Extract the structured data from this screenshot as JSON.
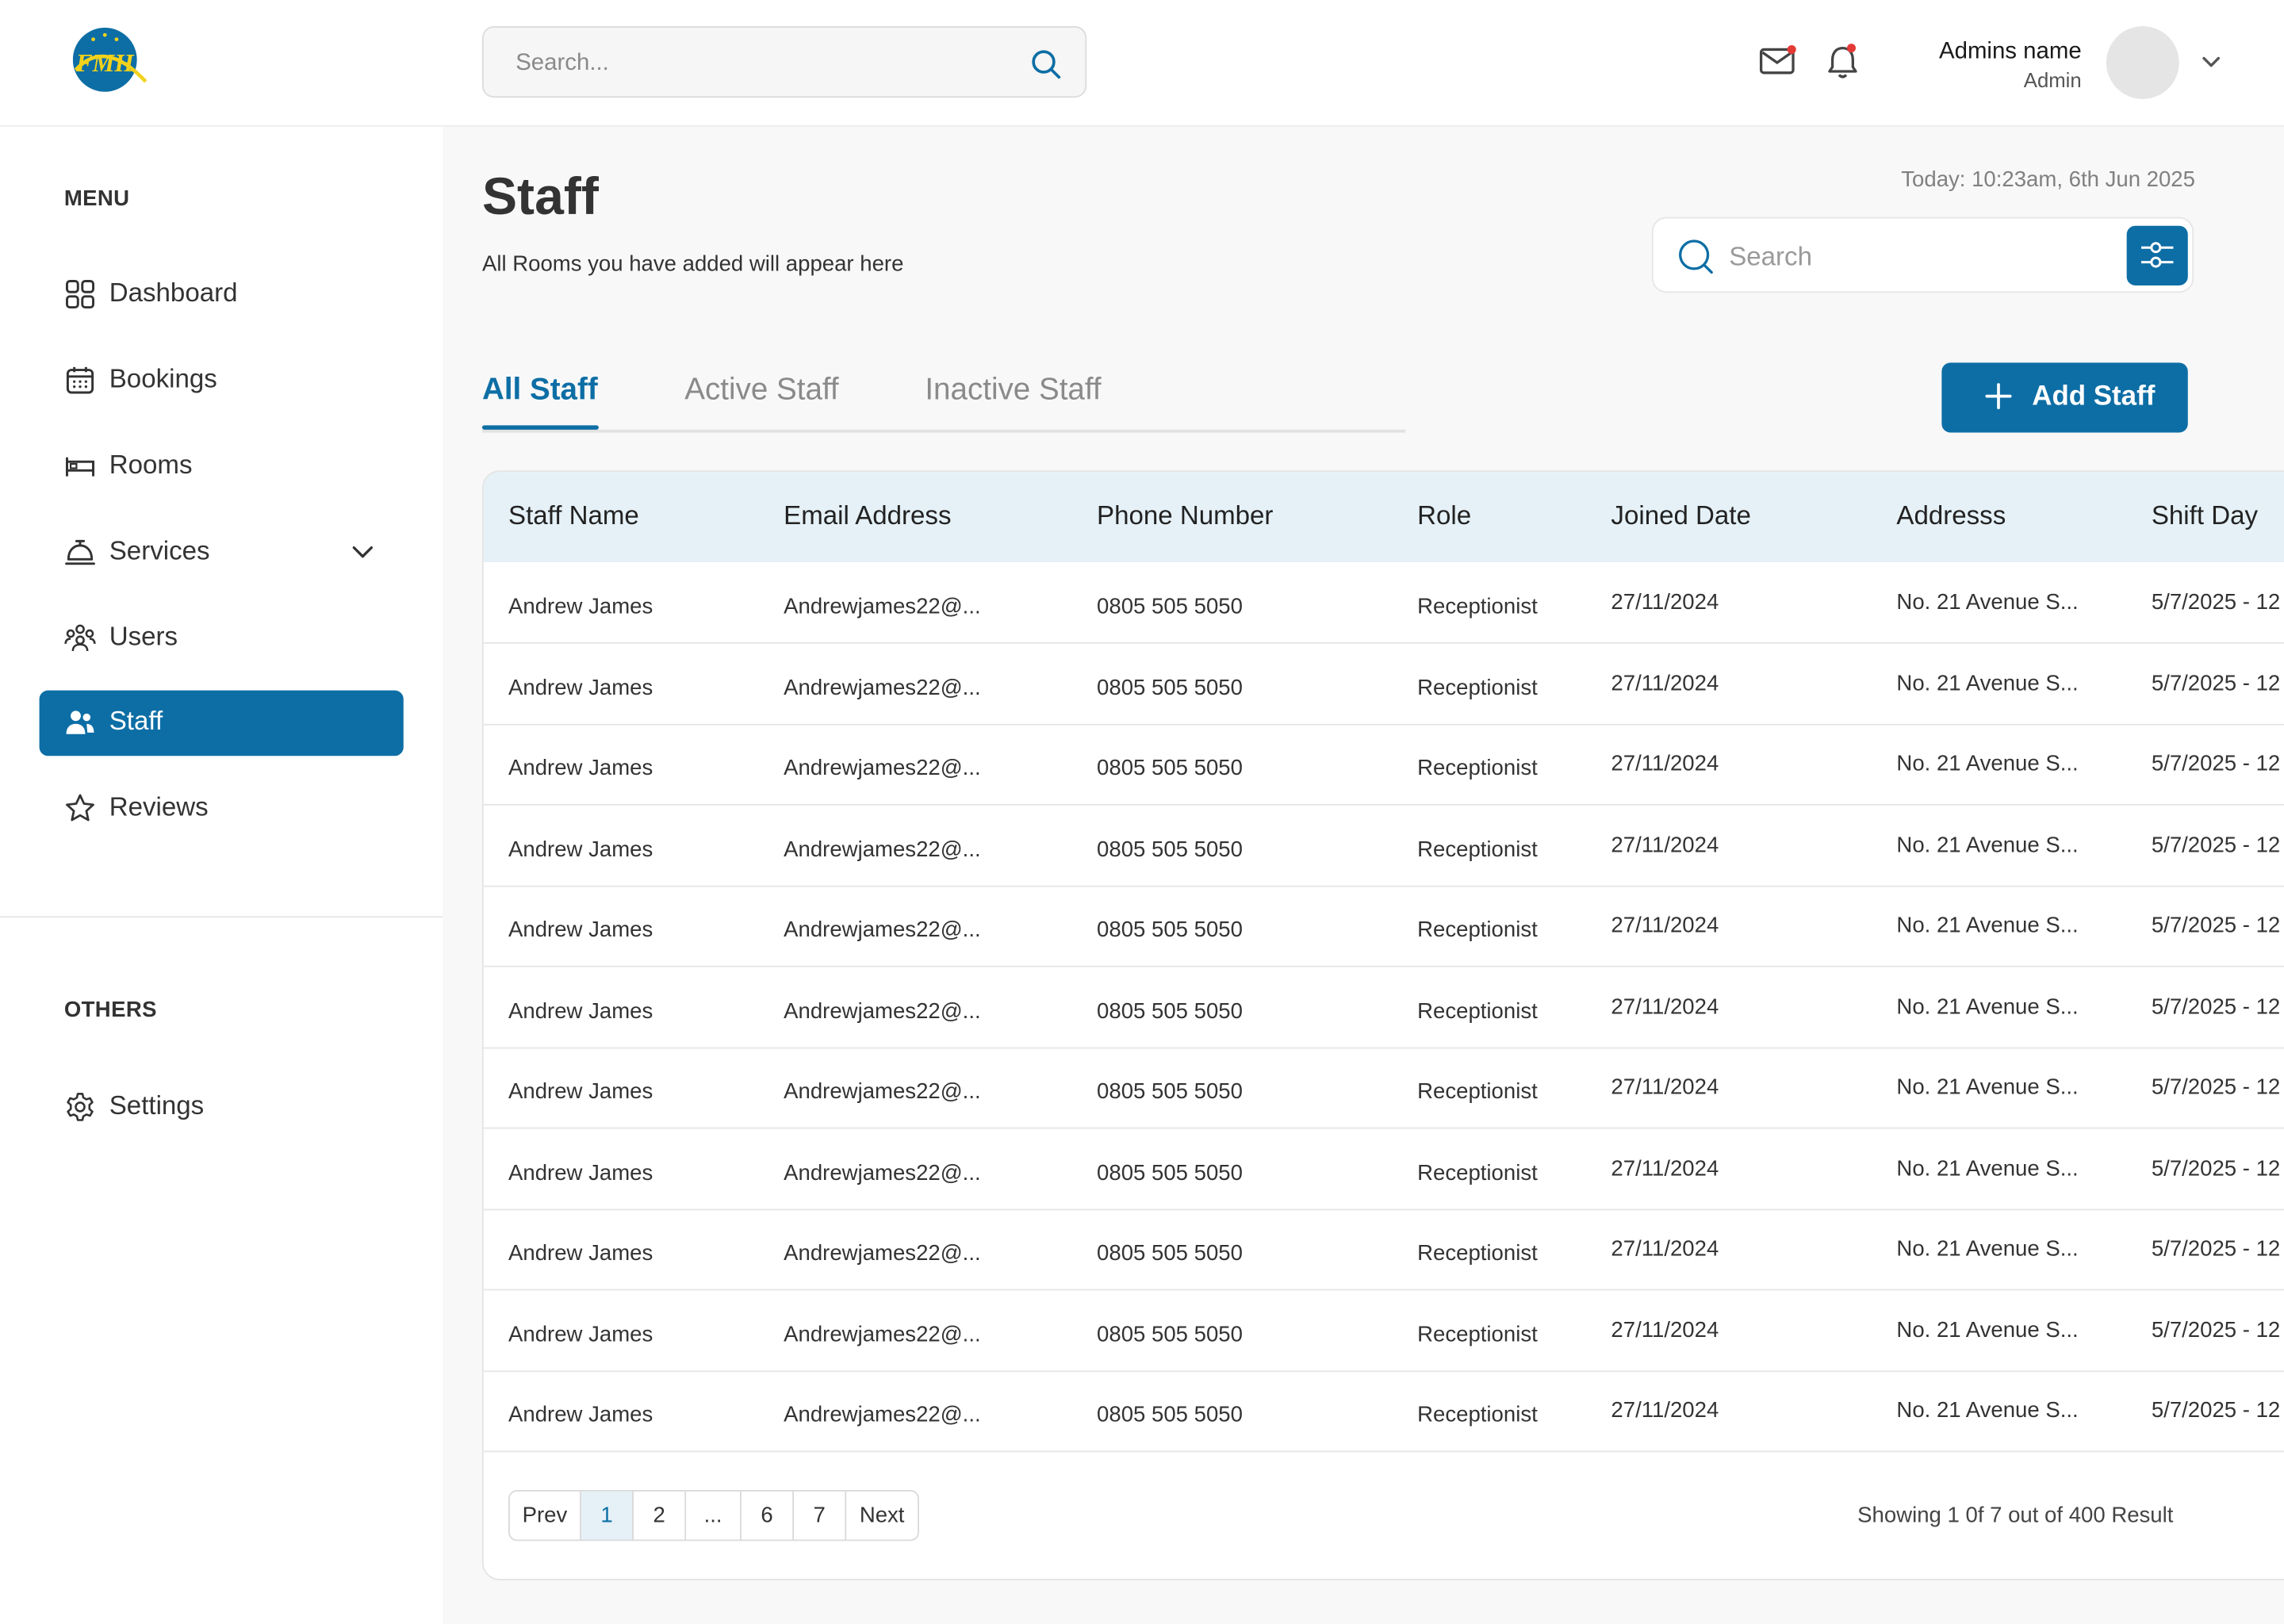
{
  "header": {
    "logo_text": "FMH",
    "search_placeholder": "Search...",
    "admin_name": "Admins name",
    "admin_role": "Admin"
  },
  "sidebar": {
    "menu_title": "MENU",
    "items": [
      {
        "label": "Dashboard",
        "icon": "grid-icon"
      },
      {
        "label": "Bookings",
        "icon": "calendar-icon"
      },
      {
        "label": "Rooms",
        "icon": "bed-icon"
      },
      {
        "label": "Services",
        "icon": "service-bell-icon"
      },
      {
        "label": "Users",
        "icon": "users-icon"
      },
      {
        "label": "Staff",
        "icon": "staff-icon"
      },
      {
        "label": "Reviews",
        "icon": "star-icon"
      }
    ],
    "others_title": "OTHERS",
    "settings_label": "Settings"
  },
  "main": {
    "title": "Staff",
    "subtitle": "All Rooms you have added will appear here",
    "today": "Today: 10:23am, 6th Jun 2025",
    "search_placeholder": "Search",
    "tabs": [
      "All Staff",
      "Active Staff",
      "Inactive Staff"
    ],
    "add_button": "Add Staff"
  },
  "table": {
    "columns": [
      "Staff Name",
      "Email Address",
      "Phone Number",
      "Role",
      "Joined Date",
      "Addresss",
      "Shift Day"
    ],
    "rows": [
      [
        "Andrew James",
        "Andrewjames22@...",
        "0805 505 5050",
        "Receptionist",
        "27/11/2024",
        "No. 21 Avenue S...",
        "5/7/2025 - 12"
      ],
      [
        "Andrew James",
        "Andrewjames22@...",
        "0805 505 5050",
        "Receptionist",
        "27/11/2024",
        "No. 21 Avenue S...",
        "5/7/2025 - 12"
      ],
      [
        "Andrew James",
        "Andrewjames22@...",
        "0805 505 5050",
        "Receptionist",
        "27/11/2024",
        "No. 21 Avenue S...",
        "5/7/2025 - 12"
      ],
      [
        "Andrew James",
        "Andrewjames22@...",
        "0805 505 5050",
        "Receptionist",
        "27/11/2024",
        "No. 21 Avenue S...",
        "5/7/2025 - 12"
      ],
      [
        "Andrew James",
        "Andrewjames22@...",
        "0805 505 5050",
        "Receptionist",
        "27/11/2024",
        "No. 21 Avenue S...",
        "5/7/2025 - 12"
      ],
      [
        "Andrew James",
        "Andrewjames22@...",
        "0805 505 5050",
        "Receptionist",
        "27/11/2024",
        "No. 21 Avenue S...",
        "5/7/2025 - 12"
      ],
      [
        "Andrew James",
        "Andrewjames22@...",
        "0805 505 5050",
        "Receptionist",
        "27/11/2024",
        "No. 21 Avenue S...",
        "5/7/2025 - 12"
      ],
      [
        "Andrew James",
        "Andrewjames22@...",
        "0805 505 5050",
        "Receptionist",
        "27/11/2024",
        "No. 21 Avenue S...",
        "5/7/2025 - 12"
      ],
      [
        "Andrew James",
        "Andrewjames22@...",
        "0805 505 5050",
        "Receptionist",
        "27/11/2024",
        "No. 21 Avenue S...",
        "5/7/2025 - 12"
      ],
      [
        "Andrew James",
        "Andrewjames22@...",
        "0805 505 5050",
        "Receptionist",
        "27/11/2024",
        "No. 21 Avenue S...",
        "5/7/2025 - 12"
      ],
      [
        "Andrew James",
        "Andrewjames22@...",
        "0805 505 5050",
        "Receptionist",
        "27/11/2024",
        "No. 21 Avenue S...",
        "5/7/2025 - 12"
      ]
    ],
    "pagination": [
      "Prev",
      "1",
      "2",
      "...",
      "6",
      "7",
      "Next"
    ],
    "current_page": "1",
    "showing": "Showing 1 0f 7 out of 400 Result"
  },
  "colors": {
    "primary": "#0d6ea5",
    "header_row": "#e5f1f7",
    "logo_blue": "#0d6ea5",
    "logo_yellow": "#f2d21b",
    "notification_dot": "#e53935"
  }
}
